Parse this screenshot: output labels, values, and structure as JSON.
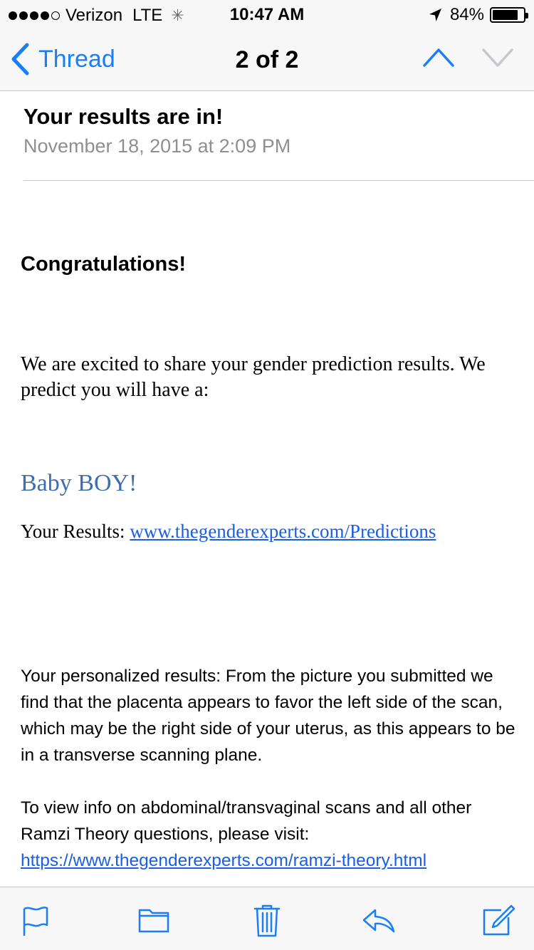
{
  "status_bar": {
    "carrier": "Verizon",
    "network": "LTE",
    "time": "10:47 AM",
    "battery": "84%",
    "battery_level": 0.84,
    "signal_bars": 4,
    "signal_total": 5
  },
  "nav": {
    "back_label": "Thread",
    "title": "2 of 2",
    "up_icon": "chevron-up-icon",
    "down_icon": "chevron-down-icon",
    "accent": "#1a7ef5"
  },
  "email": {
    "subject": "Your results are in!",
    "date": "November 18, 2015 at 2:09 PM"
  },
  "body": {
    "congrats": "Congratulations!",
    "intro": "We are excited to share your gender prediction results. We predict you will have a:",
    "prediction": "Baby BOY!",
    "results_prefix": "Your Results: ",
    "results_link": "www.thegenderexperts.com/Predictions",
    "personalized": "Your personalized results: From the picture you submitted we find that the placenta appears to favor the left side of the scan, which may be the right side of your uterus, as this appears to be in a transverse scanning plane.",
    "view_info": "To view info on abdominal/transvaginal scans and all other Ramzi Theory questions, please visit:",
    "ramzi_link": "https://www.thegenderexperts.com/ramzi-theory.html"
  },
  "toolbar": {
    "icons": [
      "flag-icon",
      "folder-icon",
      "trash-icon",
      "reply-icon",
      "compose-icon"
    ]
  }
}
